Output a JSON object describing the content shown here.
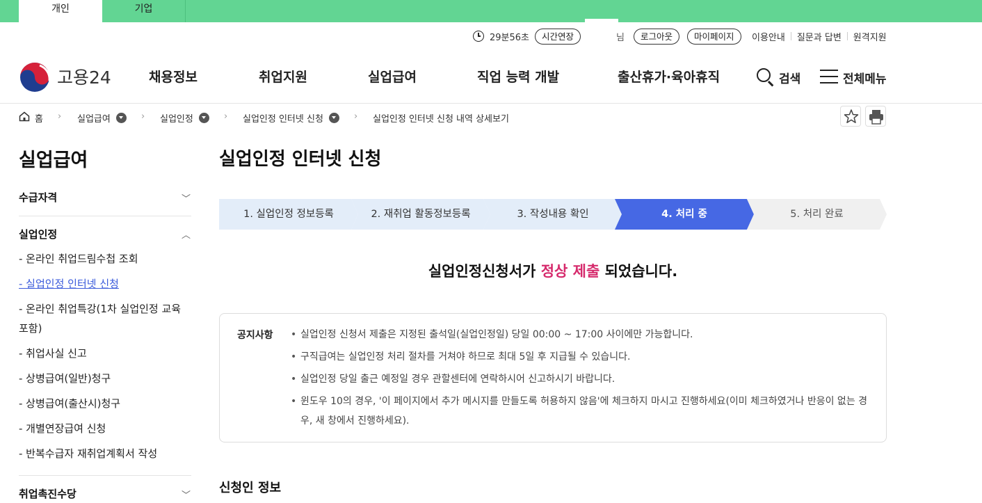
{
  "top_tabs": {
    "personal": "개인",
    "business": "기업"
  },
  "utility": {
    "timer": "29분56초",
    "extend_button": "시간연장",
    "user_suffix": "님",
    "logout_button": "로그아웃",
    "mypage_button": "마이페이지",
    "links": [
      "이용안내",
      "질문과 답변",
      "원격지원"
    ]
  },
  "header": {
    "logo_text": "고용24",
    "nav": [
      "채용정보",
      "취업지원",
      "실업급여",
      "직업 능력 개발",
      "출산휴가·육아휴직"
    ],
    "search_label": "검색",
    "menu_label": "전체메뉴"
  },
  "breadcrumb": {
    "home": "홈",
    "items": [
      "실업급여",
      "실업인정",
      "실업인정 인터넷 신청",
      "실업인정 인터넷 신청 내역 상세보기"
    ]
  },
  "sidebar": {
    "title": "실업급여",
    "sections": [
      {
        "label": "수급자격"
      },
      {
        "label": "실업인정"
      },
      {
        "label": "취업촉진수당"
      }
    ],
    "items": [
      "- 온라인 취업드림수첩 조회",
      "- 실업인정 인터넷 신청",
      "- 온라인 취업특강(1차 실업인정 교육 포함)",
      "- 취업사실 신고",
      "- 상병급여(일반)청구",
      "- 상병급여(출산시)청구",
      "- 개별연장급여 신청",
      "- 반복수급자 재취업계획서 작성"
    ]
  },
  "main": {
    "title": "실업인정 인터넷 신청",
    "steps": [
      "1. 실업인정 정보등록",
      "2. 재취업 활동정보등록",
      "3. 작성내용 확인",
      "4. 처리 중",
      "5. 처리 완료"
    ],
    "current_step": 4,
    "result_prefix": "실업인정신청서가 ",
    "result_highlight": "정상 제출",
    "result_suffix": " 되었습니다.",
    "notice_label": "공지사항",
    "notices": [
      "실업인정 신청서 제출은 지정된 출석일(실업인정일) 당일 00:00 ~ 17:00 사이에만 가능합니다.",
      "구직급여는 실업인정 처리 절차를 거쳐야 하므로 최대 5일 후 지급될 수 있습니다.",
      "실업인정 당일 출근 예정일 경우 관할센터에 연락하시어 신고하시기 바랍니다.",
      "윈도우 10의 경우, '이 페이지에서 추가 메시지를 만들도록 허용하지 않음'에 체크하지 마시고 진행하세요(이미 체크하였거나 반응이 없는 경우, 새 창에서 진행하세요)."
    ],
    "applicant_section": "신청인 정보"
  },
  "colors": {
    "top_strip": "#62d593",
    "step_active": "#4668e4",
    "step_done": "#e3edf9",
    "highlight": "#d62a6c",
    "active_link": "#3b5bdb"
  }
}
